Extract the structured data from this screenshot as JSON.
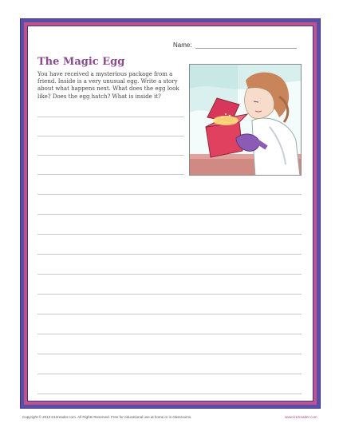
{
  "header": {
    "name_label": "Name:"
  },
  "worksheet": {
    "title": "The Magic Egg",
    "prompt": "You have received a mysterious package from a friend. Inside is a very unusual egg. Write a story about what happens next. What does the egg look like? Does the egg hatch? What is inside it?"
  },
  "illustration": {
    "icon": "girl-opening-box-illustration"
  },
  "footer": {
    "copyright": "Copyright © 2013 K12reader.com. All Rights Reserved. Free for educational use at home or in classrooms.",
    "site": "www.k12reader.com"
  },
  "colors": {
    "border_outer": "#5a4fa8",
    "border_mid": "#c0528e",
    "title": "#8a4a8f"
  }
}
